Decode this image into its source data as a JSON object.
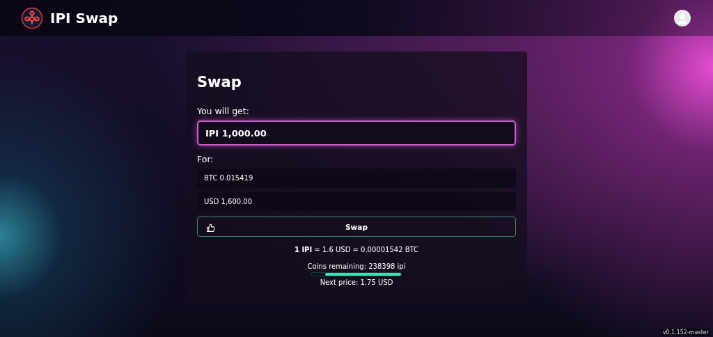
{
  "header": {
    "title": "IPI Swap"
  },
  "card": {
    "title": "Swap",
    "get_label": "You will get:",
    "get_value": "IPI 1,000.00",
    "for_label": "For:",
    "for_values": [
      "BTC 0.015419",
      "USD 1,600.00"
    ],
    "button": "Swap",
    "rate": "**1 IPI** = 1.6 USD = 0.00001542 BTC",
    "coins_remaining": "Coins remaining: 238398 ipi",
    "progress": {
      "level": 0.85
    },
    "next_price": "Next price: 1.75 USD"
  },
  "version": "v0.1.152-master"
}
